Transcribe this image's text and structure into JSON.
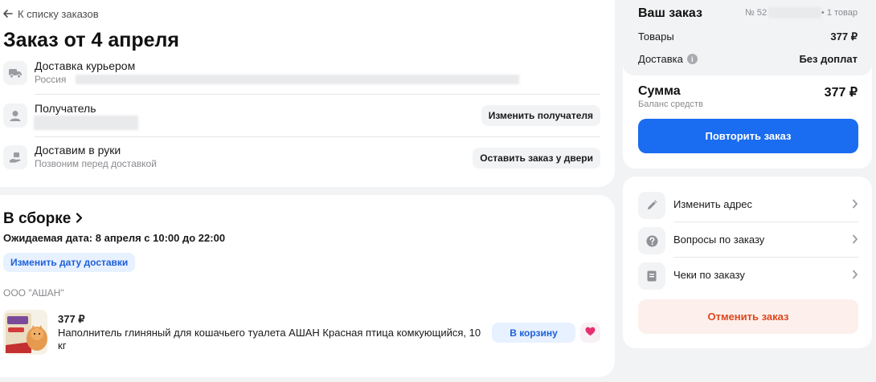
{
  "header": {
    "back_link": "К списку заказов",
    "title": "Заказ от 4 апреля"
  },
  "delivery_info": {
    "method": {
      "title": "Доставка курьером",
      "subtitle": "Россия"
    },
    "recipient": {
      "title": "Получатель",
      "action": "Изменить получателя"
    },
    "handover": {
      "title": "Доставим в руки",
      "subtitle": "Позвоним перед доставкой",
      "action": "Оставить заказ у двери"
    }
  },
  "assembly": {
    "status_title": "В сборке",
    "expected_date": "Ожидаемая дата: 8 апреля с 10:00 до 22:00",
    "change_date_button": "Изменить дату доставки",
    "seller": "ООО \"АШАН\"",
    "product": {
      "price": "377 ₽",
      "name": "Наполнитель глиняный для кошачьего туалета АШАН Красная птица комкующийся, 10 кг",
      "to_cart_button": "В корзину"
    }
  },
  "summary": {
    "title": "Ваш заказ",
    "order_number": "№ 52",
    "items_count": "• 1 товар",
    "goods_label": "Товары",
    "goods_value": "377 ₽",
    "delivery_label": "Доставка",
    "delivery_value": "Без доплат",
    "total_label": "Сумма",
    "total_value": "377 ₽",
    "balance_label": "Баланс средств",
    "repeat_button": "Повторить заказ"
  },
  "actions": {
    "items": [
      {
        "label": "Изменить адрес"
      },
      {
        "label": "Вопросы по заказу"
      },
      {
        "label": "Чеки по заказу"
      }
    ],
    "cancel_button": "Отменить заказ"
  },
  "colors": {
    "accent": "#1a6cf0",
    "danger": "#e0461e",
    "favorite": "#e5316f",
    "background": "#f2f3f5"
  }
}
